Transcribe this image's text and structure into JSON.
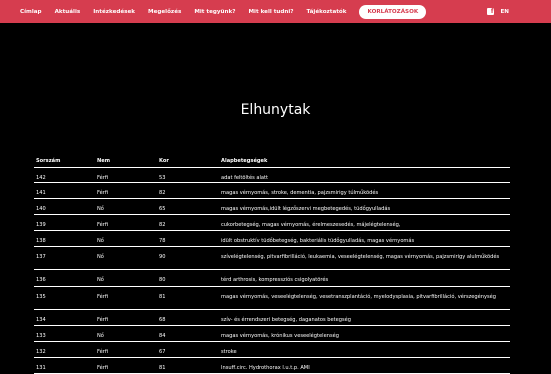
{
  "nav": {
    "items": [
      "Címlap",
      "Aktuális",
      "Intézkedések",
      "Megelőzés",
      "Mit tegyünk?",
      "Mit kell tudni?",
      "Tájékoztatók"
    ],
    "cta_label": "KORLÁTOZÁSOK",
    "facebook_icon": "facebook-icon",
    "lang_label": "EN"
  },
  "page": {
    "title": "Elhunytak"
  },
  "table": {
    "headers": [
      "Sorszám",
      "Nem",
      "Kor",
      "Alapbetegségek"
    ],
    "rows": [
      [
        "142",
        "Férfi",
        "53",
        "adat feltöltés alatt"
      ],
      [
        "141",
        "Férfi",
        "82",
        "magas vérnyomás, stroke, dementia, pajzsmirigy túlműködés"
      ],
      [
        "140",
        "Nő",
        "65",
        "magas vérnyomás,idült légzőszervi megbetegedés, tüdőgyulladás"
      ],
      [
        "139",
        "Férfi",
        "82",
        "cukorbetegség, magas vérnyomás, érelmeszesedés, májelégtelenség,"
      ],
      [
        "138",
        "Nő",
        "78",
        "idült obstruktív tüdőbetegség, bakteriális tüdőgyulladás, magas vérnyomás"
      ],
      [
        "137",
        "Nő",
        "90",
        "szívelégtelenség, pitvarfibrilláció, leukaemia, veseelégtelenség, magas vérnyomás, pajzsmirigy alulműködés"
      ],
      [
        "136",
        "Nő",
        "80",
        "térd arthrosis, kompressziós csigolyatörés"
      ],
      [
        "135",
        "Férfi",
        "81",
        "magas vérnyomás, veseelégtelenség, vesetranszplantáció, myelodysplasia, pitvarfibrilláció, vérszegénység"
      ],
      [
        "134",
        "Férfi",
        "68",
        "szív- és érrendszeri betegség, daganatos betegség"
      ],
      [
        "133",
        "Nő",
        "84",
        "magas vérnyomás, krónikus veseelégtelenség"
      ],
      [
        "132",
        "Férfi",
        "67",
        "stroke"
      ],
      [
        "131",
        "Férfi",
        "81",
        "Insuff.circ. Hydrothorax l.u.t.p. AMI"
      ]
    ]
  }
}
